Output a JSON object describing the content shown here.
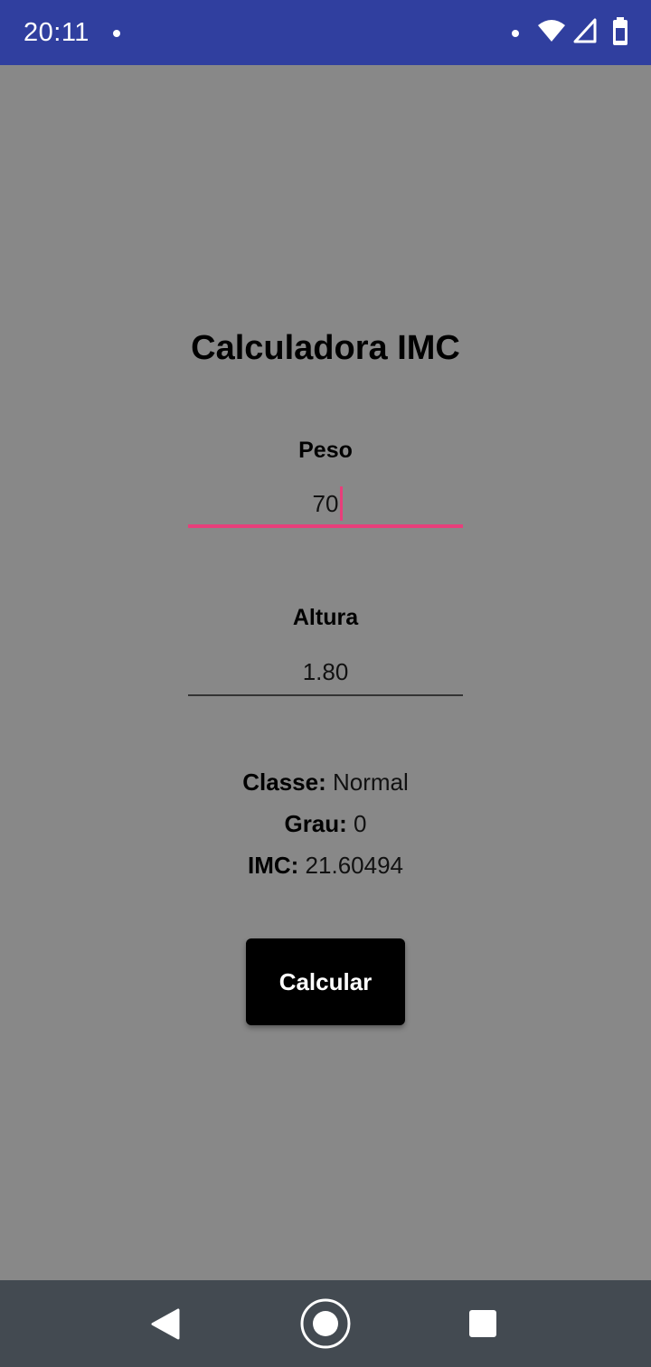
{
  "status_bar": {
    "time": "20:11",
    "bg_color": "#303f9f",
    "icons": [
      "notification-dot",
      "wifi-icon",
      "signal-icon",
      "battery-icon"
    ]
  },
  "app": {
    "title": "Calculadora IMC",
    "background": "#888888",
    "accent": "#e83e7b"
  },
  "form": {
    "peso_label": "Peso",
    "peso_value": "70",
    "altura_label": "Altura",
    "altura_value": "1.80"
  },
  "results": {
    "classe_label": "Classe:",
    "classe_value": "Normal",
    "grau_label": "Grau:",
    "grau_value": "0",
    "imc_label": "IMC:",
    "imc_value": "21.60494"
  },
  "button": {
    "calcular_label": "Calcular"
  },
  "nav_bar": {
    "buttons": [
      "back-icon",
      "home-icon",
      "recents-icon"
    ]
  }
}
